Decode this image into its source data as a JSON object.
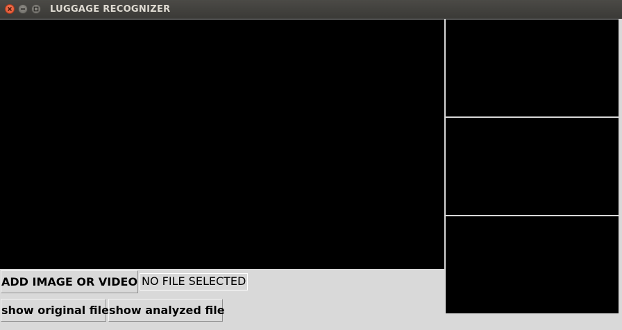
{
  "window": {
    "title": "LUGGAGE RECOGNIZER"
  },
  "controls": {
    "add_button_label": "ADD IMAGE OR VIDEO",
    "file_status": "NO FILE SELECTED",
    "show_original_label": "show original file",
    "show_analyzed_label": "show analyzed file"
  },
  "icons": {
    "close": "close-icon",
    "minimize": "minimize-icon",
    "maximize": "maximize-icon"
  },
  "colors": {
    "canvas_background": "#000000",
    "window_background": "#d9d9d9",
    "titlebar": "#3c3b37",
    "close_button": "#e95420"
  }
}
